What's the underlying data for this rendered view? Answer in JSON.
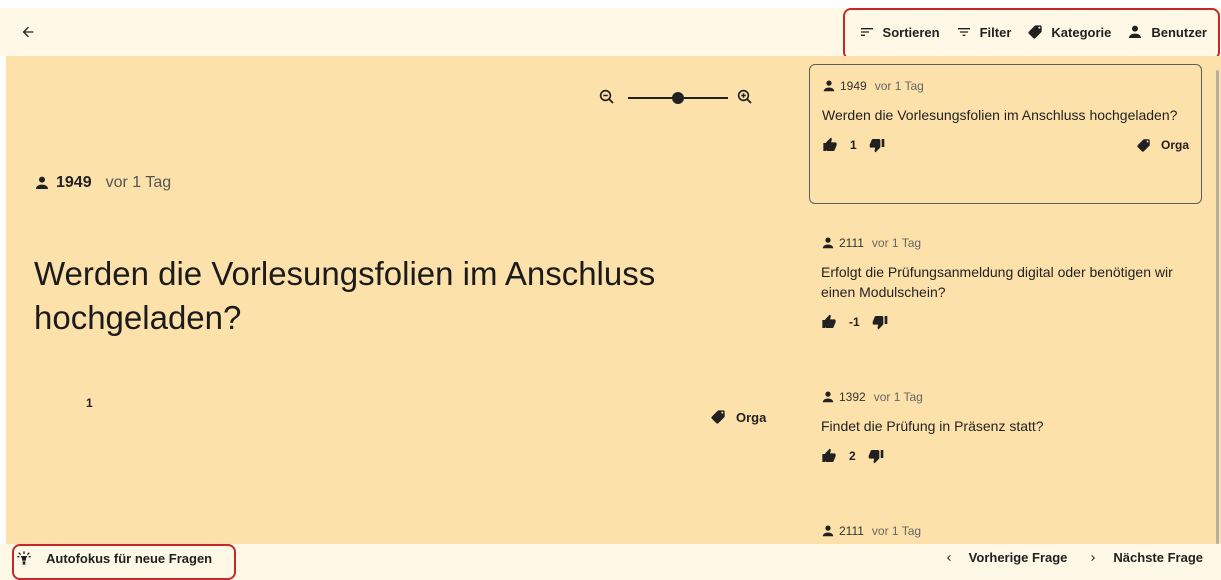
{
  "header": {
    "back_icon": "arrow-left-icon",
    "toolbar": [
      {
        "icon": "sort-icon",
        "label": "Sortieren"
      },
      {
        "icon": "filter-icon",
        "label": "Filter"
      },
      {
        "icon": "tag-icon",
        "label": "Kategorie"
      },
      {
        "icon": "person-icon",
        "label": "Benutzer"
      }
    ]
  },
  "zoom": {
    "level": 0.5
  },
  "main": {
    "user": "1949",
    "time": "vor 1 Tag",
    "question": "Werden die Vorlesungsfolien im Anschluss hochgeladen?",
    "votes": "1",
    "tag": "Orga"
  },
  "sidebar": {
    "questions": [
      {
        "user": "1949",
        "time": "vor 1 Tag",
        "text": "Werden die Vorlesungsfolien im Anschluss hochgeladen?",
        "votes": "1",
        "tag": "Orga",
        "active": true
      },
      {
        "user": "2111",
        "time": "vor 1 Tag",
        "text": "Erfolgt die Prüfungsanmeldung digital oder benötigen wir einen Modulschein?",
        "votes": "-1",
        "tag": ""
      },
      {
        "user": "1392",
        "time": "vor 1 Tag",
        "text": "Findet die Prüfung in Präsenz statt?",
        "votes": "2",
        "tag": ""
      },
      {
        "user": "2111",
        "time": "vor 1 Tag",
        "text": "",
        "votes": "",
        "tag": ""
      }
    ]
  },
  "footer": {
    "autofocus_label": "Autofokus für neue Fragen",
    "prev_label": "Vorherige Frage",
    "next_label": "Nächste Frage"
  },
  "colors": {
    "accent_panel": "#fde1aa",
    "bar": "#fff8e7",
    "highlight": "#c62828"
  }
}
